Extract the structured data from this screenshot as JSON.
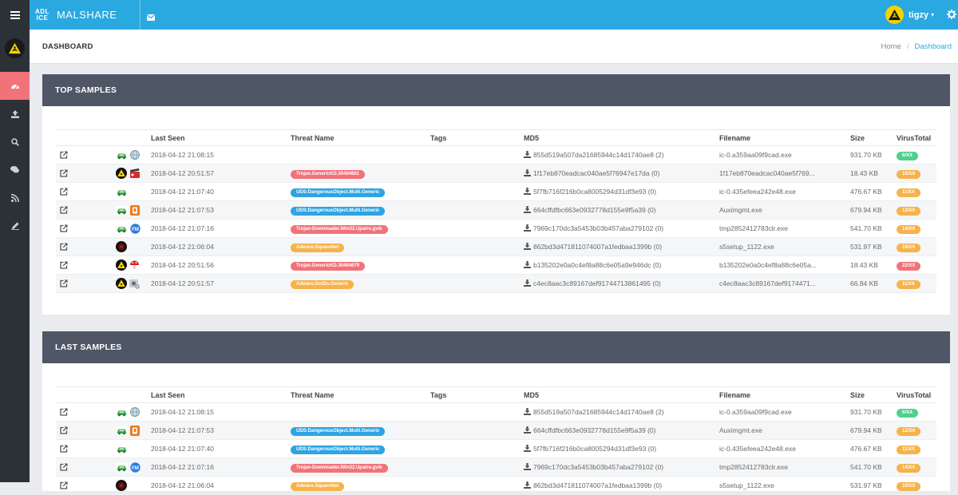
{
  "brand": {
    "line1": "ADL",
    "line2": "ICE",
    "name": "MALSHARE"
  },
  "user": {
    "name": "tigzy",
    "caret": "▾"
  },
  "header": {
    "title": "DASHBOARD",
    "breadcrumb": [
      "Home",
      "Dashboard"
    ]
  },
  "columns": [
    "",
    "",
    "Last Seen",
    "Threat Name",
    "Tags",
    "MD5",
    "Filename",
    "Size",
    "VirusTotal"
  ],
  "colors": {
    "topbar": "#2aa8e0",
    "sidebar": "#2c3138",
    "panelHeader": "#4f5766",
    "red": "#f2727a",
    "blue": "#2ea4e2",
    "orange": "#f7b24a",
    "green": "#4fd18b"
  },
  "top_samples": {
    "title": "TOP SAMPLES",
    "rows": [
      {
        "icons": [
          "car-icon",
          "globe-icon"
        ],
        "last_seen": "2018-04-12 21:08:15",
        "threat": "",
        "threat_color": "",
        "tags": "",
        "md5": "855d519a507da21685944c14d1740ae8 (2)",
        "filename": "ic-0.a359aa09f9cad.exe",
        "size": "931.70 KB",
        "vt": "6/XX",
        "vt_color": "#4fd18b"
      },
      {
        "icons": [
          "hazard-icon",
          "clapper-icon"
        ],
        "last_seen": "2018-04-12 20:51:57",
        "threat": "Trojan.GenericKD.30494661",
        "threat_color": "#f2727a",
        "tags": "",
        "md5": "1f17eb870eadcac040ae5f76947e17da (0)",
        "filename": "1f17eb870eadcac040ae5f769...",
        "size": "18.43 KB",
        "vt": "18/XX",
        "vt_color": "#f7b24a"
      },
      {
        "icons": [
          "car-icon"
        ],
        "last_seen": "2018-04-12 21:07:40",
        "threat": "UDS:DangerousObject.Multi.Generic",
        "threat_color": "#2ea4e2",
        "tags": "",
        "md5": "5f7fb716f216b0ca8005294d31df3e93 (0)",
        "filename": "ic-0.435efeea242e48.exe",
        "size": "476.67 KB",
        "vt": "11/XX",
        "vt_color": "#f7b24a"
      },
      {
        "icons": [
          "car-icon",
          "orange-app-icon"
        ],
        "last_seen": "2018-04-12 21:07:53",
        "threat": "UDS:DangerousObject.Multi.Generic",
        "threat_color": "#2ea4e2",
        "tags": "",
        "md5": "664cffdfbc663e0932778d155e9f5a39 (0)",
        "filename": "Auximgmt.exe",
        "size": "679.94 KB",
        "vt": "12/XX",
        "vt_color": "#f7b24a"
      },
      {
        "icons": [
          "car-icon",
          "blue-app-icon"
        ],
        "last_seen": "2018-04-12 21:07:16",
        "threat": "Trojan-Downloader.Win32.Upatre.gvik",
        "threat_color": "#f2727a",
        "tags": "",
        "md5": "7969c170dc3a5453b03b457aba279102 (0)",
        "filename": "tmp2852412783clr.exe",
        "size": "541.70 KB",
        "vt": "14/XX",
        "vt_color": "#f7b24a"
      },
      {
        "icons": [
          "dark-circle-icon"
        ],
        "last_seen": "2018-04-12 21:06:04",
        "threat": "Adware.SquareNet",
        "threat_color": "#f7b24a",
        "tags": "",
        "md5": "862bd3d471811074007a1fedbaa1399b (0)",
        "filename": "s5setup_1122.exe",
        "size": "531.97 KB",
        "vt": "10/XX",
        "vt_color": "#f7b24a"
      },
      {
        "icons": [
          "hazard-icon",
          "mushroom-icon"
        ],
        "last_seen": "2018-04-12 20:51:56",
        "threat": "Trojan.GenericKD.30494679",
        "threat_color": "#f2727a",
        "tags": "",
        "md5": "b135202e0a0c4ef8a88c6e05a9e946dc (0)",
        "filename": "b135202e0a0c4ef8a88c6e05a...",
        "size": "18.43 KB",
        "vt": "22/XX",
        "vt_color": "#f2727a"
      },
      {
        "icons": [
          "hazard-icon",
          "gear-app-icon"
        ],
        "last_seen": "2018-04-12 20:51:57",
        "threat": "Adware.DotDo.Generic",
        "threat_color": "#f7b24a",
        "tags": "",
        "md5": "c4ec8aac3c89167def91744713861495 (0)",
        "filename": "c4ec8aac3c89167def9174471...",
        "size": "66.84 KB",
        "vt": "11/XX",
        "vt_color": "#f7b24a"
      }
    ]
  },
  "last_samples": {
    "title": "LAST SAMPLES",
    "rows": [
      {
        "icons": [
          "car-icon",
          "globe-icon"
        ],
        "last_seen": "2018-04-12 21:08:15",
        "threat": "",
        "threat_color": "",
        "tags": "",
        "md5": "855d519a507da21685944c14d1740ae8 (2)",
        "filename": "ic-0.a359aa09f9cad.exe",
        "size": "931.70 KB",
        "vt": "6/XX",
        "vt_color": "#4fd18b"
      },
      {
        "icons": [
          "car-icon",
          "orange-app-icon"
        ],
        "last_seen": "2018-04-12 21:07:53",
        "threat": "UDS:DangerousObject.Multi.Generic",
        "threat_color": "#2ea4e2",
        "tags": "",
        "md5": "664cffdfbc663e0932778d155e9f5a39 (0)",
        "filename": "Auximgmt.exe",
        "size": "679.94 KB",
        "vt": "12/XX",
        "vt_color": "#f7b24a"
      },
      {
        "icons": [
          "car-icon"
        ],
        "last_seen": "2018-04-12 21:07:40",
        "threat": "UDS:DangerousObject.Multi.Generic",
        "threat_color": "#2ea4e2",
        "tags": "",
        "md5": "5f7fb716f216b0ca8005294d31df3e93 (0)",
        "filename": "ic-0.435efeea242e48.exe",
        "size": "476.67 KB",
        "vt": "11/XX",
        "vt_color": "#f7b24a"
      },
      {
        "icons": [
          "car-icon",
          "blue-app-icon"
        ],
        "last_seen": "2018-04-12 21:07:16",
        "threat": "Trojan-Downloader.Win32.Upatre.gvik",
        "threat_color": "#f2727a",
        "tags": "",
        "md5": "7969c170dc3a5453b03b457aba279102 (0)",
        "filename": "tmp2852412783clr.exe",
        "size": "541.70 KB",
        "vt": "14/XX",
        "vt_color": "#f7b24a"
      },
      {
        "icons": [
          "dark-circle-icon"
        ],
        "last_seen": "2018-04-12 21:06:04",
        "threat": "Adware.SquareNet",
        "threat_color": "#f7b24a",
        "tags": "",
        "md5": "862bd3d471811074007a1fedbaa1399b (0)",
        "filename": "s5setup_1122.exe",
        "size": "531.97 KB",
        "vt": "10/XX",
        "vt_color": "#f7b24a"
      }
    ]
  }
}
